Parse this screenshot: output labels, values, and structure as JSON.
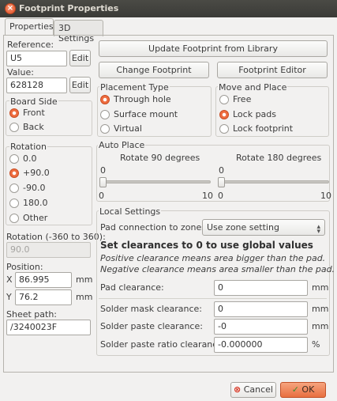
{
  "window": {
    "title": "Footprint Properties",
    "close_glyph": "×"
  },
  "tabs": [
    {
      "label": "Properties"
    },
    {
      "label": "3D Settings"
    }
  ],
  "left": {
    "reference_label": "Reference:",
    "reference_value": "U5",
    "value_label": "Value:",
    "value_value": "628128",
    "edit_label": "Edit",
    "board_side": {
      "title": "Board Side",
      "options": [
        "Front",
        "Back"
      ],
      "selected": "Front"
    },
    "rotation": {
      "title": "Rotation",
      "options": [
        "0.0",
        "+90.0",
        "-90.0",
        "180.0",
        "Other"
      ],
      "selected": "+90.0"
    },
    "rotation_custom_label": "Rotation (-360 to 360):",
    "rotation_custom_value": "90.0",
    "position_label": "Position:",
    "x_label": "X",
    "x_value": "86.995",
    "y_label": "Y",
    "y_value": "76.2",
    "unit": "mm",
    "sheet_path_label": "Sheet path:",
    "sheet_path_value": "/3240023F"
  },
  "right": {
    "update_button": "Update Footprint from Library",
    "change_button": "Change Footprint",
    "editor_button": "Footprint Editor",
    "placement_type": {
      "title": "Placement Type",
      "options": [
        "Through hole",
        "Surface mount",
        "Virtual"
      ],
      "selected": "Through hole"
    },
    "move_place": {
      "title": "Move and Place",
      "options": [
        "Free",
        "Lock pads",
        "Lock footprint"
      ],
      "selected": "Lock pads"
    },
    "auto_place": {
      "title": "Auto Place",
      "rot90": {
        "label": "Rotate 90 degrees",
        "value": "0",
        "min": "0",
        "max": "10"
      },
      "rot180": {
        "label": "Rotate 180 degrees",
        "value": "0",
        "min": "0",
        "max": "10"
      }
    },
    "local": {
      "title": "Local Settings",
      "pad_conn_label": "Pad connection to zones:",
      "pad_conn_value": "Use zone setting",
      "heading": "Set clearances to 0 to use global values",
      "note1": "Positive clearance means area bigger than the pad.",
      "note2": "Negative clearance means area smaller than the pad.",
      "pad_clearance_label": "Pad clearance:",
      "pad_clearance_value": "0",
      "pad_clearance_unit": "mm",
      "mask_label": "Solder mask clearance:",
      "mask_value": "0",
      "mask_unit": "mm",
      "paste_label": "Solder paste clearance:",
      "paste_value": "-0",
      "paste_unit": "mm",
      "ratio_label": "Solder paste ratio clearance:",
      "ratio_value": "-0.000000",
      "ratio_unit": "%"
    }
  },
  "footer": {
    "cancel_label": "Cancel",
    "ok_label": "OK"
  },
  "colors": {
    "accent": "#ee6c3f",
    "titlebar": "#3b3b37",
    "cancel_icon": "#d9321f",
    "ok_icon": "#3a8d2d"
  }
}
